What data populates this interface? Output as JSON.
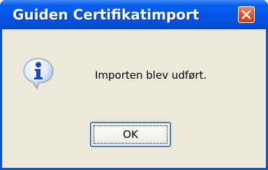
{
  "window": {
    "title": "Guiden Certifikatimport"
  },
  "dialog": {
    "message": "Importen blev udført.",
    "ok_label": "OK"
  },
  "icons": {
    "close": "close-icon",
    "info": "info-icon"
  },
  "colors": {
    "titlebar": "#0556e6",
    "client": "#ece9d8",
    "close_button": "#e0532c"
  }
}
